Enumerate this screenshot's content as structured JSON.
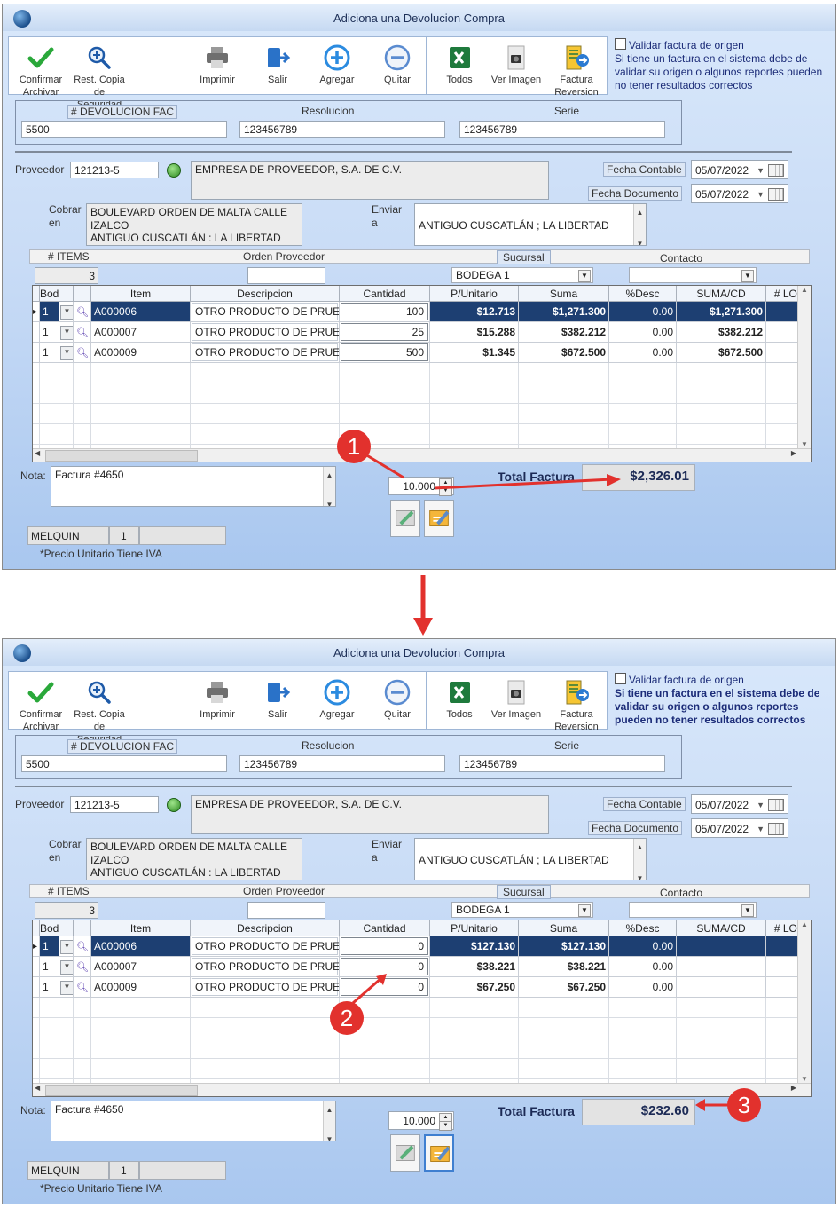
{
  "window_title": "Adiciona una Devolucion Compra",
  "toolbar": {
    "confirmar": "Confirmar\nArchivar",
    "confirmar_l1": "Confirmar",
    "confirmar_l2": "Archivar",
    "rest_l1": "Rest. Copia",
    "rest_l2": "de Seguridad",
    "imprimir": "Imprimir",
    "salir": "Salir",
    "agregar": "Agregar",
    "quitar": "Quitar",
    "todos": "Todos",
    "ver_imagen": "Ver Imagen",
    "factura_l1": "Factura",
    "factura_l2": "Reversion"
  },
  "validar": {
    "label": "Validar factura de origen",
    "note": "Si tiene un factura en el sistema debe de validar su origen o algunos reportes pueden no tener resultados correctos"
  },
  "doc": {
    "devolucion_label": "# DEVOLUCION FAC",
    "resolucion_label": "Resolucion",
    "serie_label": "Serie",
    "devolucion_value": "5500",
    "resolucion_value": "123456789",
    "serie_value": "123456789"
  },
  "proveedor": {
    "label": "Proveedor",
    "code": "121213-5",
    "name": "EMPRESA DE PROVEEDOR, S.A. DE C.V.",
    "fecha_contable_label": "Fecha Contable",
    "fecha_documento_label": "Fecha Documento",
    "fecha_contable": "05/07/2022",
    "fecha_documento": "05/07/2022"
  },
  "cobrar": {
    "label_l1": "Cobrar",
    "label_l2": "en",
    "line1": "BOULEVARD ORDEN DE MALTA CALLE",
    "line2": "IZALCO",
    "line3": "ANTIGUO CUSCATLÁN : LA LIBERTAD"
  },
  "enviar": {
    "label_l1": "Enviar",
    "label_l2": "a",
    "value": "ANTIGUO CUSCATLÁN ; LA LIBERTAD"
  },
  "header_row": {
    "items_label": "# ITEMS",
    "orden_label": "Orden Proveedor",
    "sucursal_label": "Sucursal",
    "contacto_label": "Contacto",
    "items_value": "3",
    "sucursal_value": "BODEGA 1"
  },
  "grid_columns": [
    "Bodega",
    "Item",
    "Descripcion",
    "Cantidad",
    "P/Unitario",
    "Suma",
    "%Desc",
    "SUMA/CD",
    "# LOTE"
  ],
  "before": {
    "rows": [
      {
        "bodega": "1",
        "item": "A000006",
        "desc": "OTRO PRODUCTO DE PRUE",
        "cantidad": "100",
        "punit": "$12.713",
        "suma": "$1,271.300",
        "desc_pct": "0.00",
        "sumacd": "$1,271.300"
      },
      {
        "bodega": "1",
        "item": "A000007",
        "desc": "OTRO PRODUCTO DE PRUE",
        "cantidad": "25",
        "punit": "$15.288",
        "suma": "$382.212",
        "desc_pct": "0.00",
        "sumacd": "$382.212"
      },
      {
        "bodega": "1",
        "item": "A000009",
        "desc": "OTRO PRODUCTO DE PRUE",
        "cantidad": "500",
        "punit": "$1.345",
        "suma": "$672.500",
        "desc_pct": "0.00",
        "sumacd": "$672.500"
      }
    ],
    "spinner": "10.000",
    "total": "$2,326.01"
  },
  "after": {
    "rows": [
      {
        "bodega": "1",
        "item": "A000006",
        "desc": "OTRO PRODUCTO DE PRUE",
        "cantidad": "0",
        "punit": "$127.130",
        "suma": "$127.130",
        "desc_pct": "0.00",
        "sumacd": ""
      },
      {
        "bodega": "1",
        "item": "A000007",
        "desc": "OTRO PRODUCTO DE PRUE",
        "cantidad": "0",
        "punit": "$38.221",
        "suma": "$38.221",
        "desc_pct": "0.00",
        "sumacd": ""
      },
      {
        "bodega": "1",
        "item": "A000009",
        "desc": "OTRO PRODUCTO DE PRUE",
        "cantidad": "0",
        "punit": "$67.250",
        "suma": "$67.250",
        "desc_pct": "0.00",
        "sumacd": ""
      }
    ],
    "spinner": "10.000",
    "total": "$232.60"
  },
  "footer": {
    "nota_label": "Nota:",
    "nota_value": "Factura  #4650",
    "total_label": "Total Factura",
    "user": "MELQUIN",
    "user_num": "1",
    "precio_note": "*Precio Unitario Tiene IVA"
  },
  "callouts": [
    "1",
    "2",
    "3"
  ],
  "colors": {
    "accent": "#1d3f72",
    "callout": "#e2312d",
    "total_text": "#1c2a55"
  }
}
